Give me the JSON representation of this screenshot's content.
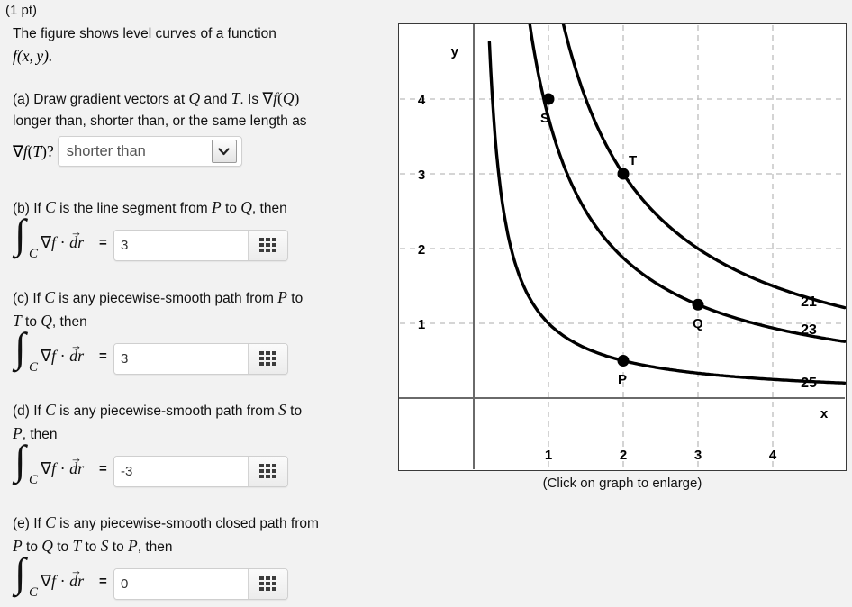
{
  "points_label": "(1 pt)",
  "intro": {
    "line1": "The figure shows level curves of a function",
    "line2_math": "f(x, y)."
  },
  "parts": [
    {
      "id": "a",
      "prompt_line1": "(a) Draw gradient vectors at Q and T. Is ∇f(Q)",
      "prompt_line2": "longer than, shorter than, or the same length as",
      "prompt_line3_math": "∇f(T)?",
      "select_value": "shorter than",
      "select_options": [
        "longer than",
        "shorter than",
        "the same length as"
      ]
    },
    {
      "id": "b",
      "prompt_line1": "(b) If C is the line segment from P to Q, then",
      "integral": "∫ᴄ ∇f · dr⃗ =",
      "answer": "3",
      "grid_button_name": "numeric-keypad"
    },
    {
      "id": "c",
      "prompt_line1": "(c) If C is any piecewise-smooth path from P to",
      "prompt_line2": "T to Q, then",
      "integral": "∫ᴄ ∇f · dr⃗ =",
      "answer": "3",
      "grid_button_name": "numeric-keypad"
    },
    {
      "id": "d",
      "prompt_line1": "(d) If C is any piecewise-smooth path from S to",
      "prompt_line2": "P, then",
      "integral": "∫ᴄ ∇f · dr⃗ =",
      "answer": "-3",
      "grid_button_name": "numeric-keypad"
    },
    {
      "id": "e",
      "prompt_line1": "(e) If C is any piecewise-smooth closed path from",
      "prompt_line2": "P to Q to T to S to P, then",
      "integral": "∫ᴄ ∇f · dr⃗ =",
      "answer": "0",
      "grid_button_name": "numeric-keypad"
    }
  ],
  "graph": {
    "caption": "(Click on graph to enlarge)",
    "x_axis_label": "x",
    "y_axis_label": "y",
    "x_ticks": [
      "1",
      "2",
      "3",
      "4"
    ],
    "y_ticks": [
      "1",
      "2",
      "3",
      "4"
    ],
    "point_labels": [
      "S",
      "T",
      "Q",
      "P"
    ],
    "curve_labels": [
      "21",
      "23",
      "25"
    ]
  },
  "chart_data": {
    "type": "line",
    "title": "",
    "xlabel": "x",
    "ylabel": "y",
    "xlim": [
      0,
      5.0
    ],
    "ylim": [
      0,
      5.0
    ],
    "x_ticks": [
      1,
      2,
      3,
      4
    ],
    "y_ticks": [
      1,
      2,
      3,
      4
    ],
    "grid": true,
    "legend": "right-end-labels",
    "series": [
      {
        "name": "21",
        "level": 21,
        "k": 6.0,
        "comment": "level curve y = 6/x, labelled 21 at right end",
        "points": [
          [
            0.75,
            8.0
          ],
          [
            1.0,
            6.0
          ],
          [
            1.25,
            4.8
          ],
          [
            1.5,
            4.0
          ],
          [
            2.0,
            3.0
          ],
          [
            2.5,
            2.4
          ],
          [
            3.0,
            2.0
          ],
          [
            3.5,
            1.71
          ],
          [
            4.0,
            1.5
          ],
          [
            4.5,
            1.33
          ],
          [
            4.85,
            1.24
          ]
        ]
      },
      {
        "name": "23",
        "level": 23,
        "k": 3.75,
        "comment": "level curve y = 3.75/x, labelled 23 at right end, passes through Q(3,1.25) and S(1,4)(approx)",
        "points": [
          [
            0.5,
            7.5
          ],
          [
            0.75,
            5.0
          ],
          [
            1.0,
            3.75
          ],
          [
            1.5,
            2.5
          ],
          [
            2.0,
            1.88
          ],
          [
            2.5,
            1.5
          ],
          [
            3.0,
            1.25
          ],
          [
            3.5,
            1.07
          ],
          [
            4.0,
            0.94
          ],
          [
            4.5,
            0.83
          ],
          [
            4.85,
            0.77
          ]
        ]
      },
      {
        "name": "25",
        "level": 25,
        "k": 1.0,
        "comment": "level curve y = 1/x, labelled 25 at right end, passes through P(2,0.5)",
        "points": [
          [
            0.2,
            5.0
          ],
          [
            0.3,
            3.33
          ],
          [
            0.4,
            2.5
          ],
          [
            0.5,
            2.0
          ],
          [
            0.75,
            1.33
          ],
          [
            1.0,
            1.0
          ],
          [
            1.5,
            0.67
          ],
          [
            2.0,
            0.5
          ],
          [
            2.5,
            0.4
          ],
          [
            3.0,
            0.33
          ],
          [
            3.5,
            0.29
          ],
          [
            4.0,
            0.25
          ],
          [
            4.5,
            0.22
          ],
          [
            4.85,
            0.21
          ]
        ]
      }
    ],
    "annotated_points": [
      {
        "label": "S",
        "x": 1.0,
        "y": 4.0,
        "on_curve": "23"
      },
      {
        "label": "T",
        "x": 2.0,
        "y": 3.0,
        "on_curve": "21"
      },
      {
        "label": "Q",
        "x": 3.0,
        "y": 1.25,
        "on_curve": "23"
      },
      {
        "label": "P",
        "x": 2.0,
        "y": 0.5,
        "on_curve": "25"
      }
    ]
  }
}
